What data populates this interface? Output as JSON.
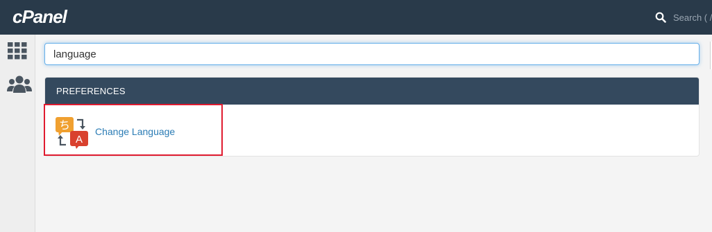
{
  "header": {
    "logo_text": "cPanel",
    "search_placeholder": "Search ( /"
  },
  "sidebar": {
    "items": [
      {
        "icon": "grid-icon"
      },
      {
        "icon": "users-icon"
      }
    ]
  },
  "search": {
    "value": "language"
  },
  "results": {
    "section_title": "PREFERENCES",
    "items": [
      {
        "label": "Change Language",
        "icon": "change-language-icon"
      }
    ]
  },
  "colors": {
    "topbar": "#293a4a",
    "panel_header": "#34495e",
    "link": "#2b7cb5",
    "highlight": "#e01b2f",
    "icon_orange": "#f0a030",
    "icon_red": "#d9412e"
  }
}
